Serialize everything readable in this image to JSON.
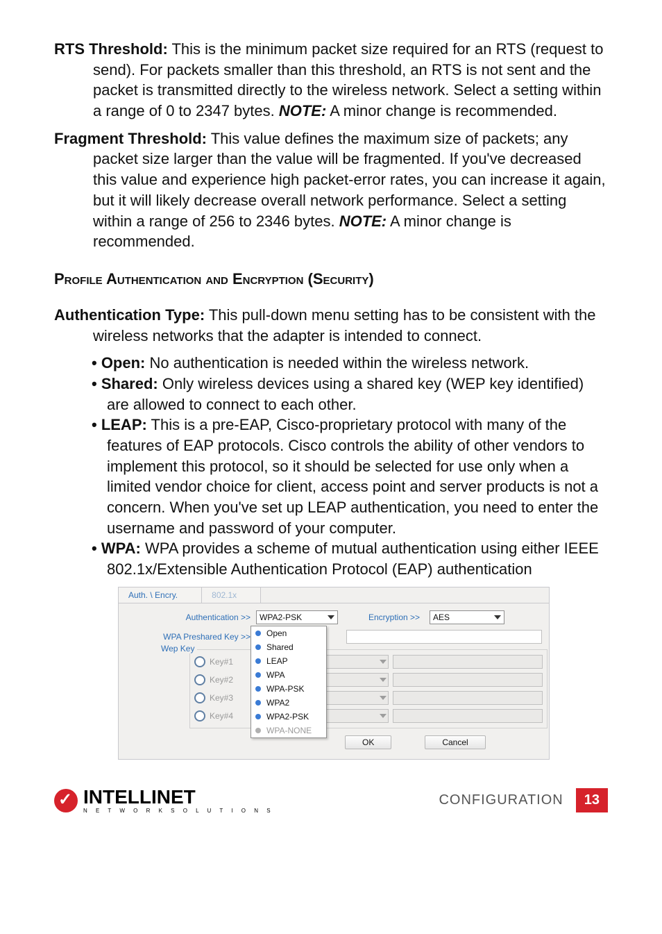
{
  "defs": {
    "rts": {
      "term": "RTS Threshold:",
      "text": " This is the minimum packet size required for an RTS (request to send). For packets smaller than this threshold, an RTS is not sent and the packet is transmitted directly to the wireless network. Select a setting within a range of 0 to 2347 bytes. ",
      "note_label": "NOTE:",
      "note_text": " A minor change is recommended."
    },
    "frag": {
      "term": "Fragment Threshold:",
      "text": " This value defines the maximum size of packets; any packet size larger than the value will be fragmented. If you've decreased this value and experience high packet-error rates, you can increase it again, but it will likely decrease overall network performance. Select a setting within a range of 256 to 2346 bytes. ",
      "note_label": "NOTE:",
      "note_text": " A minor change is recommended."
    }
  },
  "section_title": "Profile Authentication and Encryption (Security)",
  "authdef": {
    "term": "Authentication Type:",
    "text": " This pull-down menu setting has to be consistent with the wireless networks that the adapter is intended to connect."
  },
  "bullets": {
    "open": {
      "head": "• Open:",
      "text": " No authentication is needed within the wireless network."
    },
    "shared": {
      "head": "• Shared:",
      "text": " Only wireless devices using a shared key (WEP key identified) are allowed to connect to each other."
    },
    "leap": {
      "head": "• LEAP:",
      "text": " This is a pre-EAP, Cisco-proprietary protocol with many of the features of EAP protocols. Cisco controls the ability of other vendors to implement this protocol, so it should be selected for use only when a limited vendor choice for client, access point and server products is not a concern. When you've set up LEAP authentication, you need to enter the username and password of your computer."
    },
    "wpa": {
      "head": "• WPA:",
      "text": " WPA provides a scheme of mutual authentication using either IEEE 802.1x/Extensible Authentication Protocol (EAP) authentication"
    }
  },
  "dialog": {
    "tabs": {
      "t1": "Auth. \\ Encry.",
      "t2": "802.1x"
    },
    "auth_label": "Authentication >>",
    "auth_value": "WPA2-PSK",
    "enc_label": "Encryption >>",
    "enc_value": "AES",
    "preshared_label": "WPA Preshared Key >>",
    "wepkey_label": "Wep Key",
    "keys": {
      "k1": "Key#1",
      "k2": "Key#2",
      "k3": "Key#3",
      "k4": "Key#4"
    },
    "options": {
      "o1": "Open",
      "o2": "Shared",
      "o3": "LEAP",
      "o4": "WPA",
      "o5": "WPA-PSK",
      "o6": "WPA2",
      "o7": "WPA2-PSK",
      "o8": "WPA-NONE"
    },
    "ok": "OK",
    "cancel": "Cancel"
  },
  "footer": {
    "brand": "INTELLINET",
    "tagline": "N E T W O R K   S O L U T I O N S",
    "section": "CONFIGURATION",
    "page": "13"
  }
}
